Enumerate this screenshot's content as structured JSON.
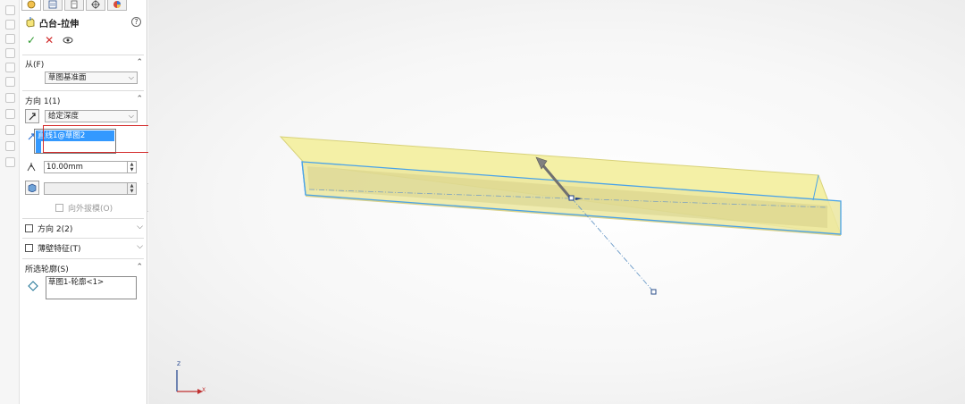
{
  "panel": {
    "title": "凸台-拉伸",
    "help": "?",
    "ok": "✓",
    "cancel": "✕",
    "from": {
      "header": "从(F)",
      "value": "草图基准面"
    },
    "direction1": {
      "header": "方向 1(1)",
      "end_condition": "给定深度",
      "direction_ref": "直线1@草图2",
      "depth": "10.00mm",
      "draft_value": "",
      "draft_outward": "向外拔模(O)"
    },
    "direction2": {
      "header": "方向 2(2)"
    },
    "thin_feature": {
      "header": "薄壁特征(T)"
    },
    "selected_contours": {
      "header": "所选轮廓(S)",
      "item": "草图1-轮廓<1>"
    }
  },
  "triad": {
    "z": "Z",
    "x": "X"
  },
  "colors": {
    "extrude_face": "#f4f0a6",
    "edge_highlight": "#4aa3e8",
    "selection": "#3399ff",
    "callout": "#d42c2c"
  }
}
